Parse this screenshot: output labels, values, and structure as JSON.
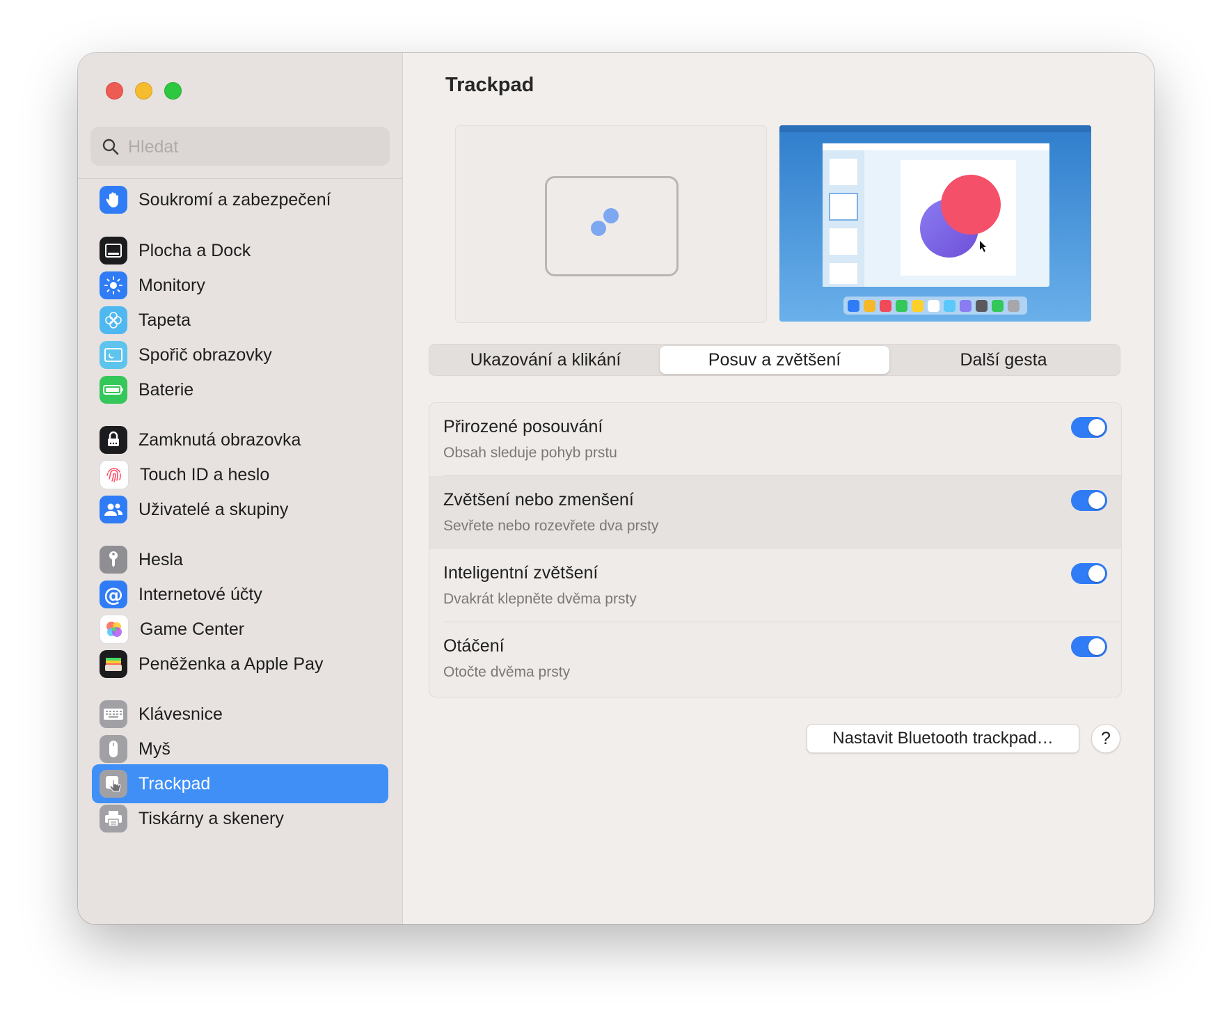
{
  "window": {
    "traffic_lights": [
      "close",
      "minimize",
      "zoom"
    ]
  },
  "search": {
    "placeholder": "Hledat"
  },
  "sidebar": {
    "items": [
      {
        "label": "Soukromí a zabezpečení",
        "icon": "hand-icon",
        "color": "#2f7cf6"
      },
      {
        "label": "Plocha a Dock",
        "icon": "dock-icon",
        "color": "#1c1c1e"
      },
      {
        "label": "Monitory",
        "icon": "sun-icon",
        "color": "#2f7cf6"
      },
      {
        "label": "Tapeta",
        "icon": "flower-icon",
        "color": "#4fb8f0"
      },
      {
        "label": "Spořič obrazovky",
        "icon": "screensaver-icon",
        "color": "#5ec4ee"
      },
      {
        "label": "Baterie",
        "icon": "battery-icon",
        "color": "#34c759"
      },
      {
        "label": "Zamknutá obrazovka",
        "icon": "lock-icon",
        "color": "#1c1c1e"
      },
      {
        "label": "Touch ID a heslo",
        "icon": "fingerprint-icon",
        "color": "#ffffff"
      },
      {
        "label": "Uživatelé a skupiny",
        "icon": "users-icon",
        "color": "#2f7cf6"
      },
      {
        "label": "Hesla",
        "icon": "key-icon",
        "color": "#8e8e93"
      },
      {
        "label": "Internetové účty",
        "icon": "at-icon",
        "color": "#2f7cf6"
      },
      {
        "label": "Game Center",
        "icon": "game-center-icon",
        "color": "#ffffff"
      },
      {
        "label": "Peněženka a Apple Pay",
        "icon": "wallet-icon",
        "color": "#1c1c1e"
      },
      {
        "label": "Klávesnice",
        "icon": "keyboard-icon",
        "color": "#a0a0a5"
      },
      {
        "label": "Myš",
        "icon": "mouse-icon",
        "color": "#a0a0a5"
      },
      {
        "label": "Trackpad",
        "icon": "trackpad-icon",
        "color": "#a0a0a5",
        "selected": true
      },
      {
        "label": "Tiskárny a skenery",
        "icon": "printer-icon",
        "color": "#a0a0a5"
      }
    ]
  },
  "main": {
    "title": "Trackpad",
    "tabs": [
      {
        "label": "Ukazování a klikání"
      },
      {
        "label": "Posuv a zvětšení",
        "active": true
      },
      {
        "label": "Další gesta"
      }
    ],
    "settings": [
      {
        "title": "Přirozené posouvání",
        "subtitle": "Obsah sleduje pohyb prstu",
        "enabled": true
      },
      {
        "title": "Zvětšení nebo zmenšení",
        "subtitle": "Sevřete nebo rozevřete dva prsty",
        "enabled": true
      },
      {
        "title": "Inteligentní zvětšení",
        "subtitle": "Dvakrát klepněte dvěma prsty",
        "enabled": true
      },
      {
        "title": "Otáčení",
        "subtitle": "Otočte dvěma prsty",
        "enabled": true
      }
    ],
    "bluetooth_button": "Nastavit Bluetooth trackpad…",
    "help_button": "?"
  },
  "colors": {
    "accent": "#2f7cf6",
    "selection": "#3f8ff7",
    "preview_desktop": "#3e8bd6"
  }
}
